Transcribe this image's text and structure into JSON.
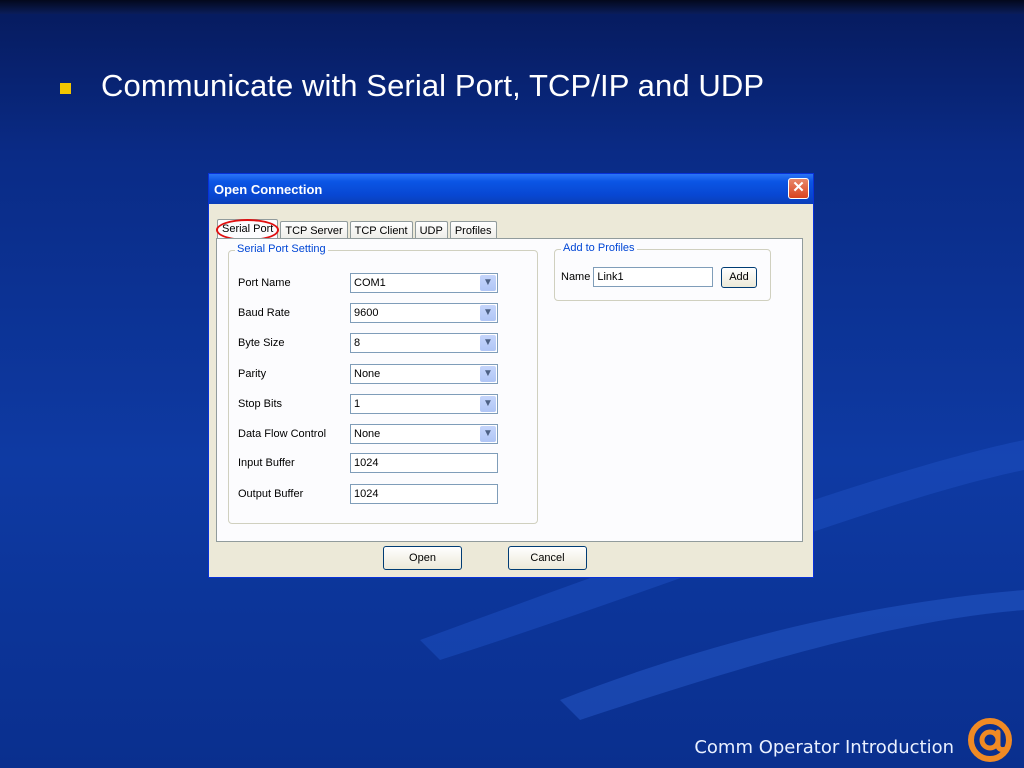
{
  "slide": {
    "bullet": "Communicate with Serial Port, TCP/IP and UDP",
    "footer": "Comm Operator Introduction"
  },
  "dialog": {
    "title": "Open Connection",
    "close": "✕",
    "tabs": [
      "Serial Port",
      "TCP Server",
      "TCP Client",
      "UDP",
      "Profiles"
    ],
    "group_title": "Serial Port Setting",
    "fields": [
      {
        "label": "Port Name",
        "value": "COM1"
      },
      {
        "label": "Baud Rate",
        "value": "9600"
      },
      {
        "label": "Byte Size",
        "value": "8"
      },
      {
        "label": "Parity",
        "value": "None"
      },
      {
        "label": "Stop Bits",
        "value": "1"
      },
      {
        "label": "Data Flow Control",
        "value": "None"
      },
      {
        "label": "Input Buffer",
        "value": "1024"
      },
      {
        "label": "Output Buffer",
        "value": "1024"
      }
    ],
    "profiles": {
      "title": "Add to Profiles",
      "name_label": "Name",
      "name_value": "Link1",
      "add_button": "Add"
    },
    "open_button": "Open",
    "cancel_button": "Cancel"
  },
  "colors": {
    "bullet": "#f2c600",
    "title_bar": "#0b55e5",
    "tab_highlight": "#e01010"
  }
}
